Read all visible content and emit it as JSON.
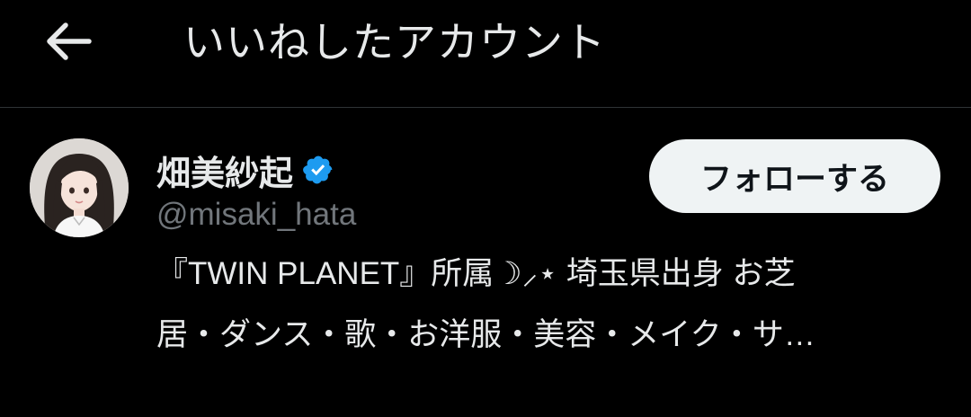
{
  "header": {
    "back_icon": "arrow-left-icon",
    "title": "いいねしたアカウント"
  },
  "user": {
    "display_name": "畑美紗起",
    "verified_icon": "verified-badge-icon",
    "verified_color": "#1d9bf0",
    "handle": "@misaki_hata",
    "follow_label": "フォローする",
    "bio_lines": [
      "『TWIN PLANET』所属☽⸝⋆ 埼玉県出身 お芝",
      "居・ダンス・歌・お洋服・美容・メイク・サ…"
    ]
  },
  "colors": {
    "background": "#000000",
    "text_primary": "#e7e9ea",
    "text_secondary": "#71767b",
    "divider": "#2f3336",
    "button_bg": "#eff3f4",
    "button_text": "#0f1419"
  }
}
